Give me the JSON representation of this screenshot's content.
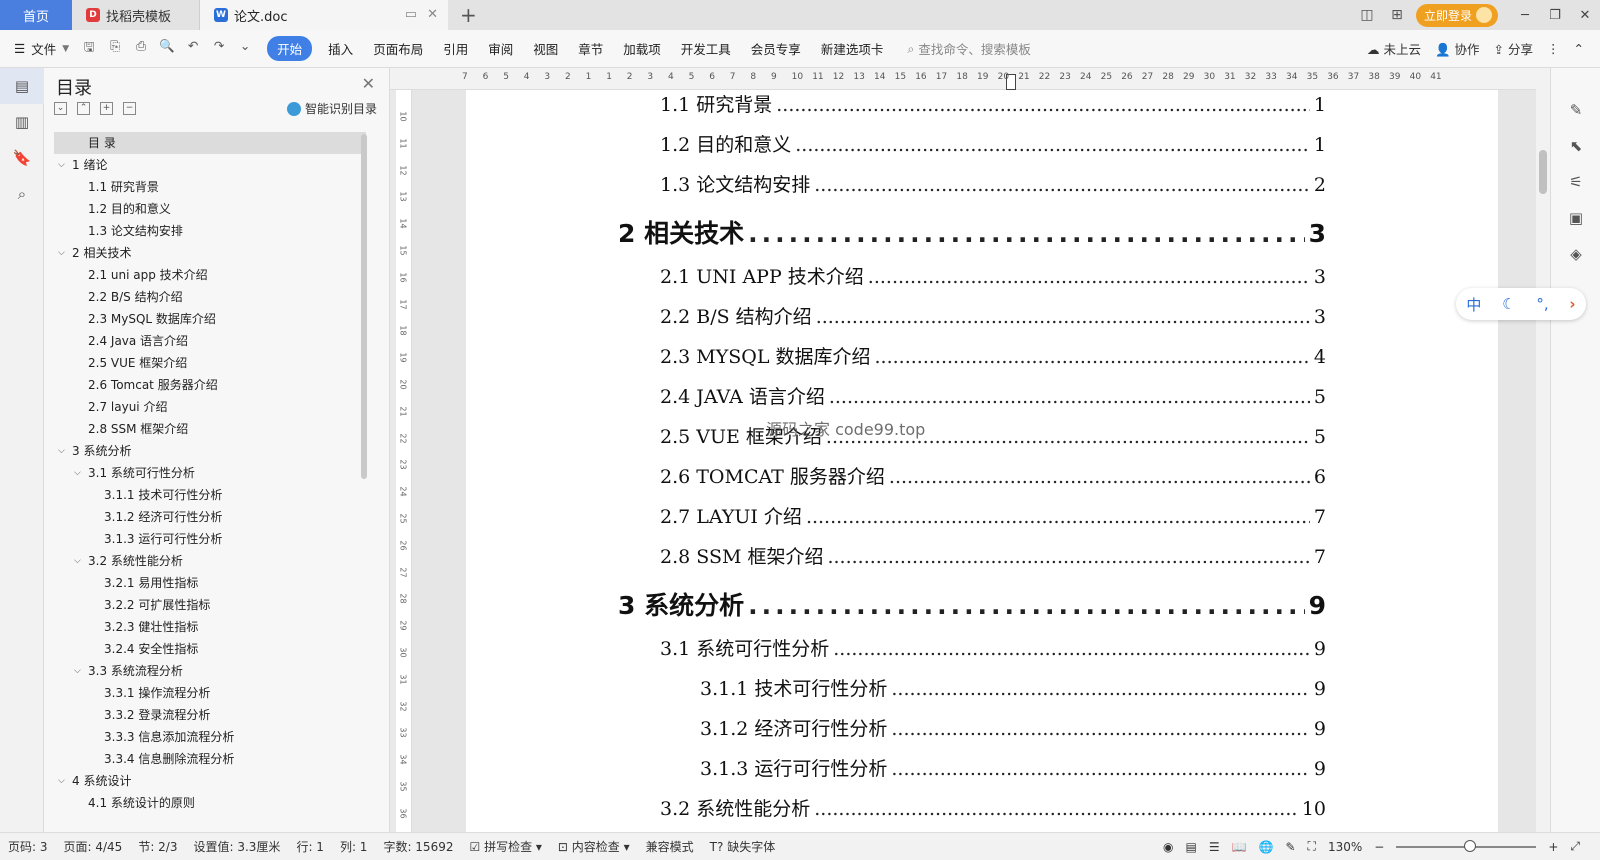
{
  "tabs": {
    "home": "首页",
    "template": "找稻壳模板",
    "doc": "论文.doc"
  },
  "titlebar": {
    "login": "立即登录"
  },
  "ribbon": {
    "file": "文件",
    "tabs": [
      "开始",
      "插入",
      "页面布局",
      "引用",
      "审阅",
      "视图",
      "章节",
      "加载项",
      "开发工具",
      "会员专享",
      "新建选项卡"
    ],
    "active_tab": "开始",
    "search_placeholder": "查找命令、搜索模板",
    "cloud": "未上云",
    "collab": "协作",
    "share": "分享"
  },
  "outline": {
    "title": "目录",
    "smart": "智能识别目录",
    "items": [
      {
        "text": "目 录",
        "indent": 0,
        "chev": false
      },
      {
        "text": "1 绪论",
        "indent": 1,
        "chev": true
      },
      {
        "text": "1.1 研究背景",
        "indent": 2,
        "chev": false
      },
      {
        "text": "1.2 目的和意义",
        "indent": 2,
        "chev": false
      },
      {
        "text": "1.3 论文结构安排",
        "indent": 2,
        "chev": false
      },
      {
        "text": "2 相关技术",
        "indent": 1,
        "chev": true
      },
      {
        "text": "2.1 uni app 技术介绍",
        "indent": 2,
        "chev": false
      },
      {
        "text": "2.2 B/S 结构介绍",
        "indent": 2,
        "chev": false
      },
      {
        "text": "2.3 MySQL 数据库介绍",
        "indent": 2,
        "chev": false
      },
      {
        "text": "2.4 Java 语言介绍",
        "indent": 2,
        "chev": false
      },
      {
        "text": "2.5 VUE 框架介绍",
        "indent": 2,
        "chev": false
      },
      {
        "text": "2.6 Tomcat 服务器介绍",
        "indent": 2,
        "chev": false
      },
      {
        "text": "2.7 layui 介绍",
        "indent": 2,
        "chev": false
      },
      {
        "text": "2.8 SSM 框架介绍",
        "indent": 2,
        "chev": false
      },
      {
        "text": "3 系统分析",
        "indent": 1,
        "chev": true
      },
      {
        "text": "3.1 系统可行性分析",
        "indent": 2,
        "chev": true
      },
      {
        "text": "3.1.1 技术可行性分析",
        "indent": 3,
        "chev": false
      },
      {
        "text": "3.1.2 经济可行性分析",
        "indent": 3,
        "chev": false
      },
      {
        "text": "3.1.3 运行可行性分析",
        "indent": 3,
        "chev": false
      },
      {
        "text": "3.2 系统性能分析",
        "indent": 2,
        "chev": true
      },
      {
        "text": "3.2.1 易用性指标",
        "indent": 3,
        "chev": false
      },
      {
        "text": "3.2.2 可扩展性指标",
        "indent": 3,
        "chev": false
      },
      {
        "text": "3.2.3 健壮性指标",
        "indent": 3,
        "chev": false
      },
      {
        "text": "3.2.4 安全性指标",
        "indent": 3,
        "chev": false
      },
      {
        "text": "3.3 系统流程分析",
        "indent": 2,
        "chev": true
      },
      {
        "text": "3.3.1 操作流程分析",
        "indent": 3,
        "chev": false
      },
      {
        "text": "3.3.2 登录流程分析",
        "indent": 3,
        "chev": false
      },
      {
        "text": "3.3.3 信息添加流程分析",
        "indent": 3,
        "chev": false
      },
      {
        "text": "3.3.4 信息删除流程分析",
        "indent": 3,
        "chev": false
      },
      {
        "text": "4 系统设计",
        "indent": 1,
        "chev": true
      },
      {
        "text": "4.1 系统设计的原则",
        "indent": 2,
        "chev": false
      }
    ]
  },
  "ruler": {
    "ticks": [
      "7",
      "6",
      "5",
      "4",
      "3",
      "2",
      "1",
      "1",
      "2",
      "3",
      "4",
      "5",
      "6",
      "7",
      "8",
      "9",
      "10",
      "11",
      "12",
      "13",
      "14",
      "15",
      "16",
      "17",
      "18",
      "19",
      "20",
      "21",
      "22",
      "23",
      "24",
      "25",
      "26",
      "27",
      "28",
      "29",
      "30",
      "31",
      "32",
      "33",
      "34",
      "35",
      "36",
      "37",
      "38",
      "39",
      "40",
      "41"
    ],
    "vticks": [
      "10",
      "11",
      "12",
      "13",
      "14",
      "15",
      "16",
      "17",
      "18",
      "19",
      "20",
      "21",
      "22",
      "23",
      "24",
      "25",
      "26",
      "27",
      "28",
      "29",
      "30",
      "31",
      "32",
      "33",
      "34",
      "35",
      "36"
    ]
  },
  "toc": [
    {
      "text": "1.1  研究背景",
      "page": "1",
      "level": 2
    },
    {
      "text": "1.2  目的和意义",
      "page": "1",
      "level": 2
    },
    {
      "text": "1.3  论文结构安排",
      "page": "2",
      "level": 2
    },
    {
      "text": "2  相关技术",
      "page": "3",
      "level": 1
    },
    {
      "text": "2.1 UNI APP 技术介绍",
      "page": "3",
      "level": 2
    },
    {
      "text": "2.2 B/S 结构介绍",
      "page": "3",
      "level": 2
    },
    {
      "text": "2.3 MYSQL 数据库介绍",
      "page": "4",
      "level": 2
    },
    {
      "text": "2.4 JAVA 语言介绍",
      "page": "5",
      "level": 2
    },
    {
      "text": "2.5 VUE 框架介绍",
      "page": "5",
      "level": 2
    },
    {
      "text": "2.6 TOMCAT 服务器介绍",
      "page": "6",
      "level": 2
    },
    {
      "text": "2.7 LAYUI 介绍",
      "page": "7",
      "level": 2
    },
    {
      "text": "2.8 SSM 框架介绍",
      "page": "7",
      "level": 2
    },
    {
      "text": "3  系统分析",
      "page": "9",
      "level": 1
    },
    {
      "text": "3.1  系统可行性分析",
      "page": "9",
      "level": 2
    },
    {
      "text": "3.1.1  技术可行性分析",
      "page": "9",
      "level": 3
    },
    {
      "text": "3.1.2  经济可行性分析",
      "page": "9",
      "level": 3
    },
    {
      "text": "3.1.3  运行可行性分析",
      "page": "9",
      "level": 3
    },
    {
      "text": "3.2  系统性能分析",
      "page": "10",
      "level": 2
    }
  ],
  "watermark": "源码之家 code99.top",
  "ime": {
    "lang": "中"
  },
  "status": {
    "page_code": "页码: 3",
    "pages": "页面: 4/45",
    "section": "节: 2/3",
    "setting": "设置值: 3.3厘米",
    "row": "行: 1",
    "col": "列: 1",
    "words": "字数: 15692",
    "spell": "拼写检查",
    "content": "内容检查",
    "compat": "兼容模式",
    "font_missing": "缺失字体",
    "zoom": "130%"
  }
}
